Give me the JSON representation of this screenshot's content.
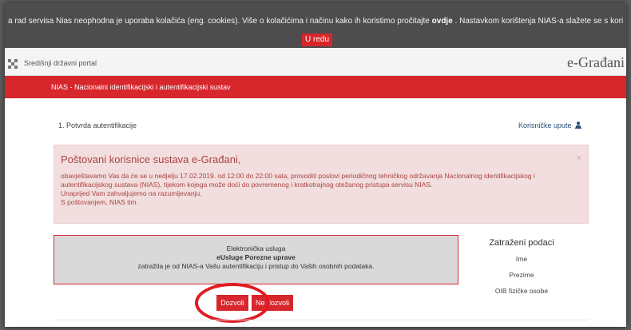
{
  "cookie_banner": {
    "text_before": "a rad servisa Nias neophodna je uporaba kolačića (eng. cookies). Više o kolačićima i načinu kako ih koristimo pročitajte",
    "link": "ovdje",
    "text_after": ". Nastavkom korištenja NIAS-a slažete se s korištenjem kolačića.",
    "button": "U redu"
  },
  "header": {
    "portal_name": "Središnji državni portal",
    "brand": "e-Građani"
  },
  "nav_bar": {
    "title": "NIAS - Nacionalni identifikacijski i autentifikacijski sustav"
  },
  "steps": {
    "current": "1. Potvrda autentifikacije",
    "manual_link": "Korisničke upute"
  },
  "alert": {
    "title": "Poštovani korisnice sustava e-Građani,",
    "lines": [
      "obavještavamo Vas da će se u nedjelju 17.02.2019. od 12:00 do 22:00 sata, provoditi poslovi periodičnog tehničkog održavanja Nacionalnog identifikacijskog i",
      "autentifikacijskog sustava (NIAS), tijekom kojega može doći do povremenog i kratkotrajnog otežanog pristupa servisu NIAS.",
      "Unaprijed Vam zahvaljujemo na razumijevanju.",
      "S poštovanjem, NIAS tim."
    ],
    "close": "×"
  },
  "service": {
    "line1": "Elektronička usluga",
    "name": "eUsluge Porezne uprave",
    "line3": "zatražila je od NIAS-a Vašu autentifikaciju i pristup do Vaših osobnih podataka."
  },
  "requested": {
    "title": "Zatraženi podaci",
    "items": [
      "Ime",
      "Prezime",
      "OIB fizičke osobe"
    ]
  },
  "buttons": {
    "allow": "Dozvoli",
    "deny": "Ne dozvoli"
  },
  "colors": {
    "brand_red": "#d7262c",
    "alert_bg": "#f2dede",
    "alert_text": "#a94442",
    "service_bg": "#d9d9d9"
  },
  "icons": {
    "manual": "user-download-icon",
    "portal": "checkerboard-logo-icon"
  }
}
